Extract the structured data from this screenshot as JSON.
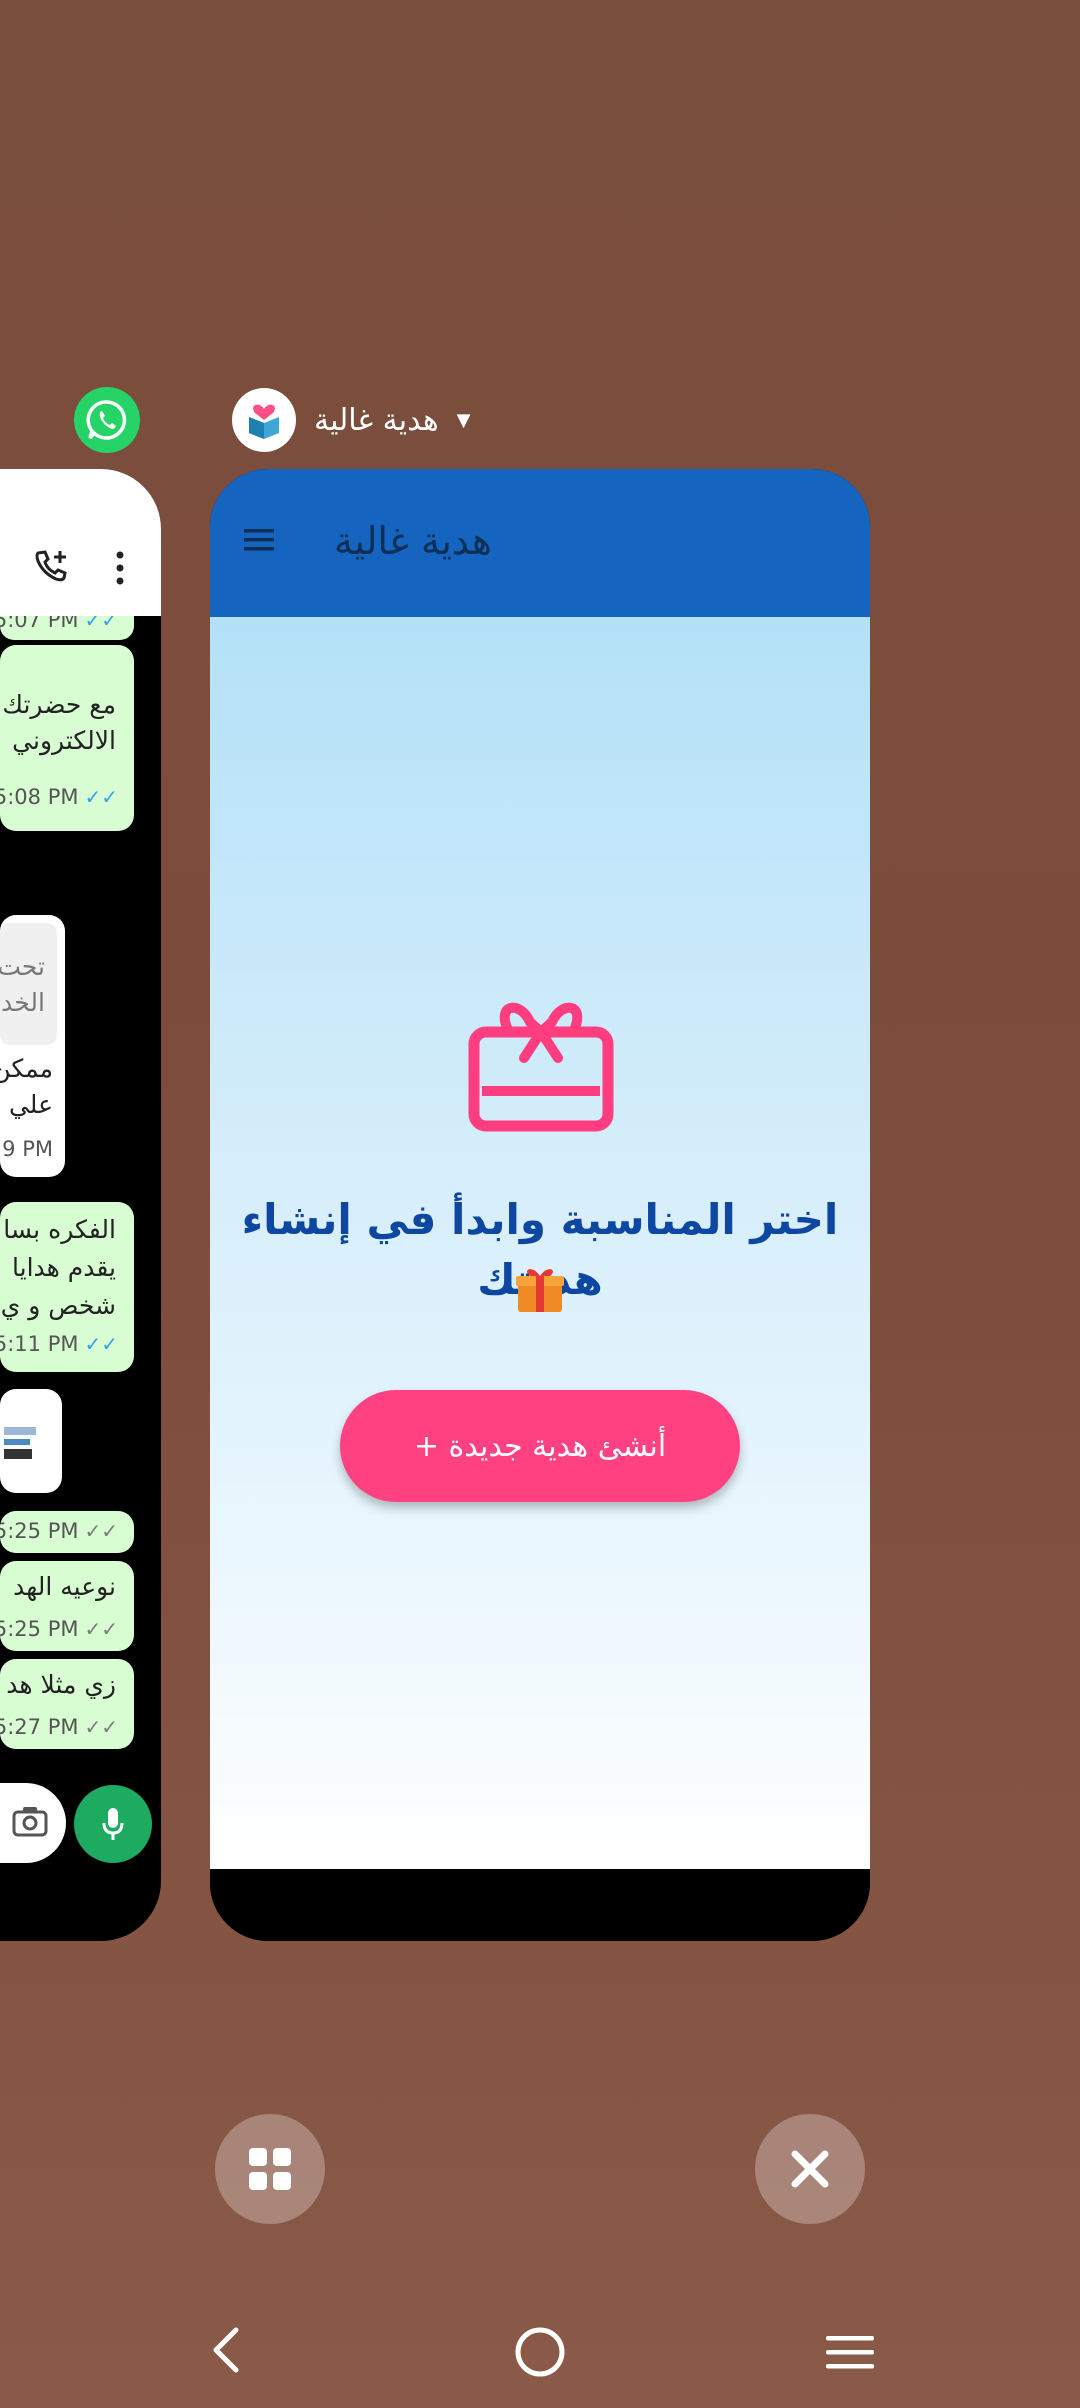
{
  "recents": {
    "left_app": {
      "icon": "whatsapp-icon",
      "messages": [
        {
          "direction": "out",
          "lines": [
            "مع حضرتك",
            "الالكتروني"
          ],
          "time": "5:08 PM",
          "status": "read"
        },
        {
          "direction": "in",
          "quoted": [
            "تحت",
            "الخدم"
          ],
          "lines": [
            "ممكن",
            "علي"
          ],
          "time": "9 PM"
        },
        {
          "direction": "out",
          "lines": [
            "الفكره بسا",
            "يقدم هدايا",
            "شخص و ي"
          ],
          "time": "5:11 PM",
          "status": "read"
        },
        {
          "direction": "out",
          "lines": [],
          "time": "5:25 PM",
          "status": "delivered"
        },
        {
          "direction": "out",
          "lines": [
            "نوعيه الهد"
          ],
          "time": "5:25 PM",
          "status": "delivered"
        },
        {
          "direction": "out",
          "lines": [
            "زي مثلا هد"
          ],
          "time": "5:27 PM",
          "status": "delivered"
        }
      ],
      "partial_top_time": "5:07 PM"
    },
    "main_app": {
      "name": "هدية غالية",
      "title": "هدية غالية",
      "headline": "اختر المناسبة وابدأ في إنشاء هديتك",
      "cta_label": "أنشئ هدية جديدة +"
    }
  },
  "colors": {
    "wallpaper": "#7d4c3a",
    "topbar": "#1565c0",
    "accent": "#ff4081",
    "headline": "#0d47a1",
    "whatsapp": "#25d366"
  },
  "icons": {
    "app_menu": "hamburger-icon",
    "feature": "gift-icon",
    "emoji": "wrapped-present-emoji",
    "split": "grid-icon",
    "clear": "close-icon",
    "back": "back-chevron-icon",
    "home": "home-circle-icon",
    "recents": "menu-lines-icon"
  }
}
